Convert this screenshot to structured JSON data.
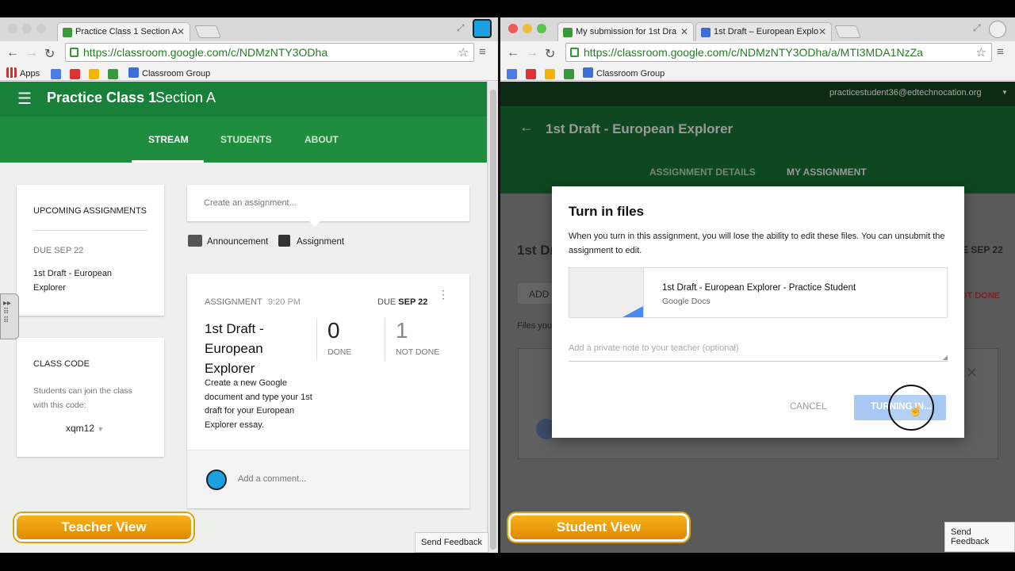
{
  "teacher": {
    "tab_title": "Practice Class 1 Section A",
    "url": "https://classroom.google.com/c/NDMzNTY3ODha",
    "bookmarks": [
      "Apps",
      "Classroom Group"
    ],
    "class_name": "Practice Class 1",
    "section": "Section A",
    "nav_tabs": [
      "STREAM",
      "STUDENTS",
      "ABOUT"
    ],
    "upcoming": {
      "heading": "UPCOMING ASSIGNMENTS",
      "due": "DUE SEP 22",
      "item": "1st Draft - European Explorer"
    },
    "class_code": {
      "heading": "CLASS CODE",
      "description": "Students can join the class with this code:",
      "code": "xqm12"
    },
    "create_placeholder": "Create an assignment...",
    "create_options": [
      "Announcement",
      "Assignment"
    ],
    "assignment": {
      "type": "ASSIGNMENT",
      "time": "9:20 PM",
      "due_prefix": "DUE",
      "due_date": "SEP 22",
      "title": "1st Draft - European Explorer",
      "description": "Create a new Google document and type your 1st draft for your European Explorer essay.",
      "done_count": "0",
      "done_label": "DONE",
      "not_done_count": "1",
      "not_done_label": "NOT DONE",
      "comment_placeholder": "Add a comment..."
    },
    "badge": "Teacher View",
    "feedback": "Send Feedback"
  },
  "student": {
    "tabs": [
      "My submission for 1st Dra",
      "1st Draft – European Explo"
    ],
    "url": "https://classroom.google.com/c/NDMzNTY3ODha/a/MTI3MDA1NzZa",
    "bookmarks": [
      "Classroom Group"
    ],
    "account": "practicestudent36@edtechnocation.org",
    "page_title": "1st Draft - European Explorer",
    "subtabs": [
      "ASSIGNMENT DETAILS",
      "MY ASSIGNMENT"
    ],
    "bg_title": "1st Dr",
    "bg_due": "E SEP 22",
    "bg_add": "ADD",
    "bg_files": "Files you",
    "bg_not_done": "OT DONE",
    "dialog": {
      "title": "Turn in files",
      "message": "When you turn in this assignment, you will lose the ability to edit these files. You can unsubmit the assignment to edit.",
      "file_name": "1st Draft - European Explorer - Practice Student",
      "file_type": "Google Docs",
      "note_placeholder": "Add a private note to your teacher (optional)",
      "cancel": "CANCEL",
      "confirm": "TURNING IN..."
    },
    "badge": "Student View",
    "feedback": "Send Feedback"
  },
  "colors": {
    "classroom_green": "#1e8e3e",
    "classroom_dark_green": "#188038",
    "accent_blue": "#8ab4f8",
    "badge_orange": "#f2a20f"
  }
}
